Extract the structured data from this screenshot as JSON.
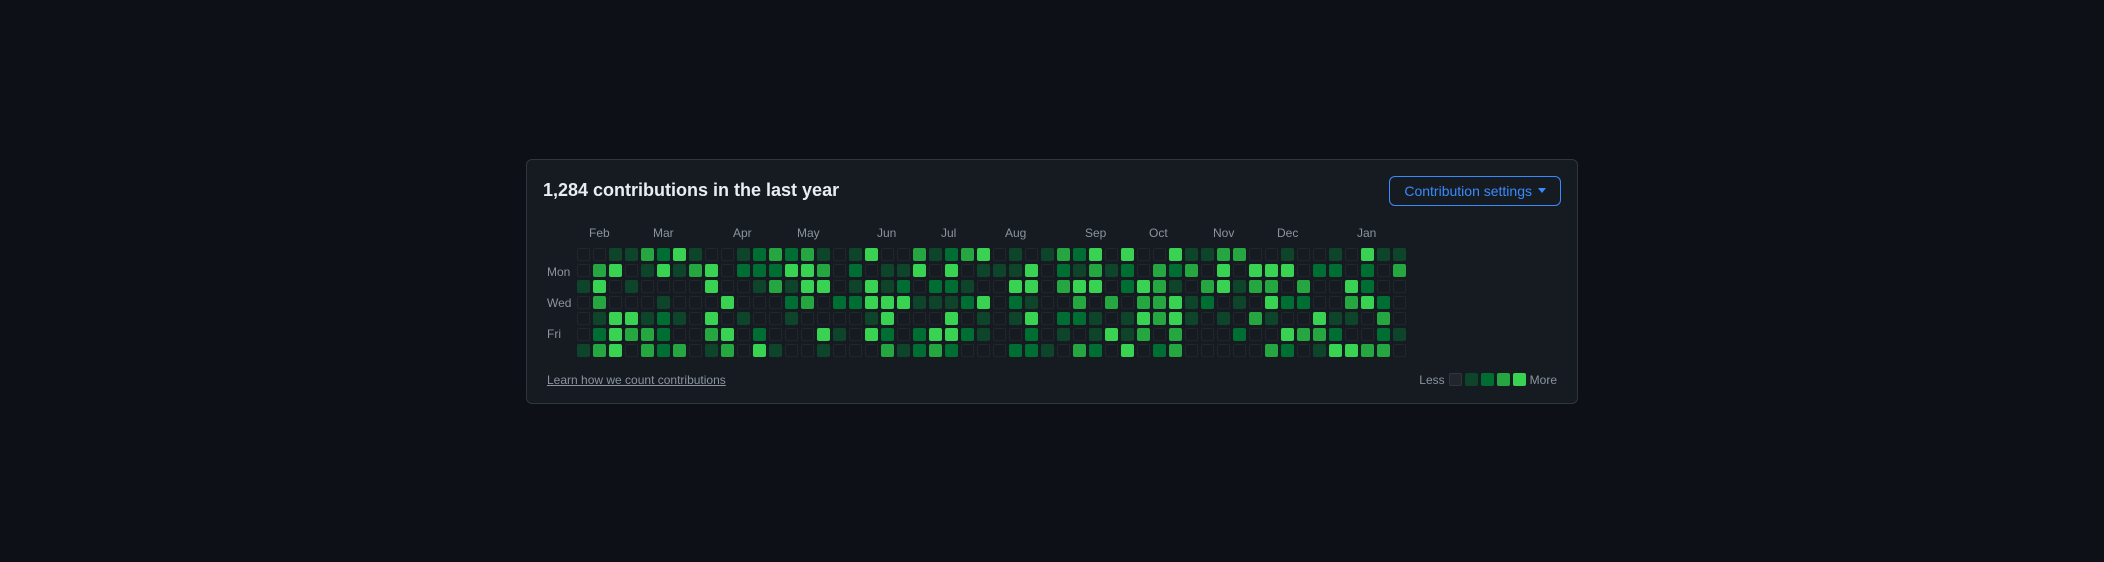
{
  "header": {
    "title": "1,284 contributions in the last year",
    "settings_button": "Contribution settings"
  },
  "months": [
    {
      "label": "Feb",
      "offset": 0
    },
    {
      "label": "Mar",
      "offset": 4
    },
    {
      "label": "Apr",
      "offset": 8
    },
    {
      "label": "May",
      "offset": 13
    },
    {
      "label": "Jun",
      "offset": 17
    },
    {
      "label": "Jul",
      "offset": 21
    },
    {
      "label": "Aug",
      "offset": 25
    },
    {
      "label": "Sep",
      "offset": 30
    },
    {
      "label": "Oct",
      "offset": 34
    },
    {
      "label": "Nov",
      "offset": 38
    },
    {
      "label": "Dec",
      "offset": 42
    },
    {
      "label": "Jan",
      "offset": 47
    }
  ],
  "day_labels": [
    "",
    "Mon",
    "",
    "Wed",
    "",
    "Fri",
    ""
  ],
  "footer": {
    "learn_link": "Learn how we count contributions",
    "less_label": "Less",
    "more_label": "More"
  },
  "legend": {
    "colors": [
      "#21262d",
      "#0e4429",
      "#006d32",
      "#26a641",
      "#39d353"
    ]
  }
}
